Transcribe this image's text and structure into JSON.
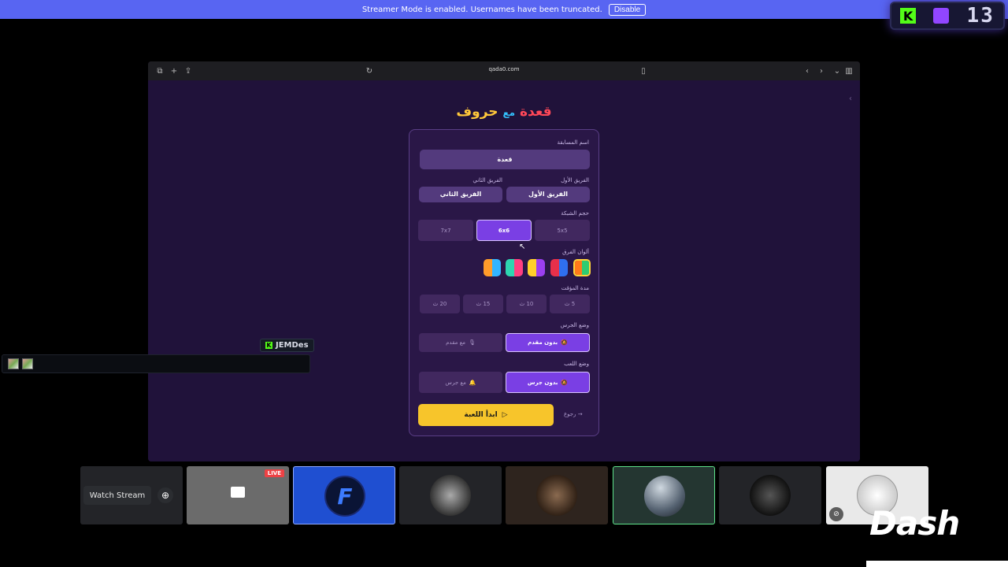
{
  "banner": {
    "message": "Streamer Mode is enabled. Usernames have been truncated.",
    "disable_label": "Disable"
  },
  "badge": {
    "count": "13",
    "kick_letter": "K"
  },
  "browser": {
    "url": "qada0.com"
  },
  "game": {
    "title_part1": "حروف",
    "title_part2": "مع",
    "title_part3": "قعدة",
    "competition_label": "اسم المسابقة",
    "competition_value": "قعدة",
    "team1_label": "الفريق الأول",
    "team1_value": "الفريق الأول",
    "team2_label": "الفريق الثاني",
    "team2_value": "الفريق الثاني",
    "grid_label": "حجم الشبكة",
    "grid_options": [
      "5x5",
      "6x6",
      "7x7"
    ],
    "colors_label": "ألوان الفرق",
    "colors": [
      [
        "#2ecc71",
        "#ff7a1a"
      ],
      [
        "#2f6ff0",
        "#e8304a"
      ],
      [
        "#9b3ff0",
        "#ffd02a"
      ],
      [
        "#ff3f80",
        "#2ed5b0"
      ],
      [
        "#33b5ff",
        "#ff9c2a"
      ]
    ],
    "timer_label": "مدة المؤقت",
    "timer_options": [
      "5 ث",
      "10 ث",
      "15 ث",
      "20 ث"
    ],
    "bell_label": "وضع الجرس",
    "bell_options": [
      "بدون مقدم",
      "مع مقدم"
    ],
    "play_label": "وضع اللعب",
    "play_options": [
      "بدون جرس",
      "مع جرس"
    ],
    "start_label": "ابدأ اللعبة",
    "back_label": "رجوع"
  },
  "chat": {
    "username": "JEMDes"
  },
  "tiles": {
    "watch_label": "Watch Stream",
    "live_label": "LIVE"
  },
  "logo": {
    "text": "Dash"
  }
}
